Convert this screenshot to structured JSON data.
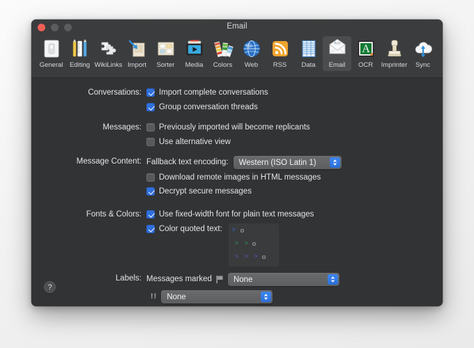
{
  "window": {
    "title": "Email",
    "traffic_lights": [
      "close",
      "minimize",
      "maximize"
    ]
  },
  "toolbar": {
    "items": [
      {
        "label": "General",
        "icon": "general-icon",
        "selected": false
      },
      {
        "label": "Editing",
        "icon": "editing-icon",
        "selected": false
      },
      {
        "label": "WikiLinks",
        "icon": "wikilinks-icon",
        "selected": false
      },
      {
        "label": "Import",
        "icon": "import-icon",
        "selected": false
      },
      {
        "label": "Sorter",
        "icon": "sorter-icon",
        "selected": false
      },
      {
        "label": "Media",
        "icon": "media-icon",
        "selected": false
      },
      {
        "label": "Colors",
        "icon": "colors-icon",
        "selected": false
      },
      {
        "label": "Web",
        "icon": "web-icon",
        "selected": false
      },
      {
        "label": "RSS",
        "icon": "rss-icon",
        "selected": false
      },
      {
        "label": "Data",
        "icon": "data-icon",
        "selected": false
      },
      {
        "label": "Email",
        "icon": "email-icon",
        "selected": true
      },
      {
        "label": "OCR",
        "icon": "ocr-icon",
        "selected": false
      },
      {
        "label": "Imprinter",
        "icon": "imprinter-icon",
        "selected": false
      },
      {
        "label": "Sync",
        "icon": "sync-icon",
        "selected": false
      }
    ]
  },
  "sections": {
    "conversations": {
      "label": "Conversations:",
      "options": [
        {
          "text": "Import complete conversations",
          "checked": true
        },
        {
          "text": "Group conversation threads",
          "checked": true
        }
      ]
    },
    "messages": {
      "label": "Messages:",
      "options": [
        {
          "text": "Previously imported will become replicants",
          "checked": false
        },
        {
          "text": "Use alternative view",
          "checked": false
        }
      ]
    },
    "message_content": {
      "label": "Message Content:",
      "encoding_label": "Fallback text encoding:",
      "encoding_value": "Western (ISO Latin 1)",
      "options": [
        {
          "text": "Download remote images in HTML messages",
          "checked": false
        },
        {
          "text": "Decrypt secure messages",
          "checked": true
        }
      ]
    },
    "fonts_colors": {
      "label": "Fonts & Colors:",
      "options": [
        {
          "text": "Use fixed-width font for plain text messages",
          "checked": true
        },
        {
          "text": "Color quoted text:",
          "checked": true
        }
      ],
      "quote_preview": [
        {
          "marks": ">",
          "color": "#2f6fe0"
        },
        {
          "marks": "> >",
          "color": "#2fc45e"
        },
        {
          "marks": "> > >",
          "color": "#7a30d8"
        }
      ]
    },
    "labels": {
      "label": "Labels:",
      "rows": [
        {
          "text": "Messages marked",
          "icon": "flag-icon",
          "value": "None"
        },
        {
          "text": "",
          "icon": "double-exclamation-icon",
          "value": "None"
        }
      ]
    }
  },
  "help": {
    "glyph": "?"
  },
  "colors": {
    "accent": "#2f6fdd",
    "window_bg": "#323335",
    "toolbar_bg": "#3b3c3e"
  }
}
